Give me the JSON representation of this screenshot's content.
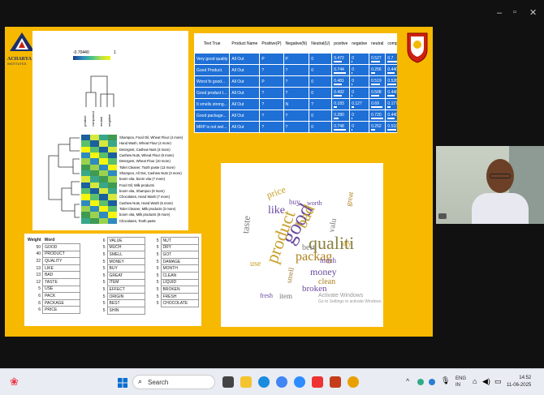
{
  "window_controls": {
    "minimize": "–",
    "maximize": "▫",
    "close": "✕"
  },
  "logo_left": {
    "text": "ACHARYA",
    "sub": "INSTITUTES"
  },
  "heatmap": {
    "scale_min": "-0.70440",
    "scale_max": "1",
    "columns": [
      "positive",
      "compound",
      "neutral",
      "negative"
    ],
    "rows": [
      "Shampoo, Food Oil, Wheat Flour (4 more)",
      "Hand Wash, Wheat Flour (4 more)",
      "Detergent, Cashew Nuts (3 more)",
      "Cashew Nuts, Wheat Flour (9 more)",
      "Detergent, Wheat Flour (10 more)",
      "Toilet Cleaner, Tooth paste (13 more)",
      "Shampoo, All Out, Cashew Nuts (3 more)",
      "boorn vita, boorn vita (7 more)",
      "Food Oil, Milk products",
      "boorn vita, Shampoo (8 more)",
      "Chocolates, Hand Wash (7 more)",
      "Cashew Nuts, Hand Wash (5 more)",
      "Toilet Cleaner, Milk products (3 more)",
      "boorn vita, Milk products (8 more)",
      "Chocolates, Tooth paste"
    ]
  },
  "sentiment_table": {
    "headers": [
      "Text True",
      "Product Name",
      "Positive(P)",
      "Negative(N)",
      "Neutral(U)",
      "positive",
      "negative",
      "neutral",
      "compound"
    ],
    "rows": [
      [
        "Very good quality",
        "All Out",
        "P",
        "P",
        "0",
        "0.472",
        "0",
        "0.527",
        "0.7"
      ],
      [
        "Good Product.",
        "All Out",
        "?",
        "?",
        "0",
        "0.744",
        "0",
        "0.256",
        "0.4404"
      ],
      [
        "Worst fo good...",
        "All Out",
        "P",
        "?",
        "0",
        "0.481",
        "0",
        "0.519",
        "0.5267"
      ],
      [
        "Good product t...",
        "All Out",
        "?",
        "?",
        "0",
        "0.492",
        "0",
        "0.508",
        "0.4404"
      ],
      [
        "It smells strong...",
        "All Out",
        "?",
        "N",
        "?",
        "0.183",
        "0.127",
        "0.69",
        "0.1779"
      ],
      [
        "Good package...",
        "All Out",
        "?",
        "?",
        "0",
        "0.280",
        "0",
        "0.720",
        "0.4404"
      ],
      [
        "MRP is not wel...",
        "All Out",
        "?",
        "?",
        "0",
        "0.748",
        "0",
        "0.252",
        "0.5106"
      ]
    ]
  },
  "word_table": {
    "col1": [
      [
        "Weight",
        "Word"
      ],
      [
        "50",
        "GOOD"
      ],
      [
        "40",
        "PRODUCT"
      ],
      [
        "22",
        "QUALITY"
      ],
      [
        "13",
        "LIKE"
      ],
      [
        "13",
        "BAD"
      ],
      [
        "12",
        "TASTE"
      ],
      [
        "5",
        "USE"
      ],
      [
        "6",
        "PACK"
      ],
      [
        "6",
        "PACKAGE"
      ],
      [
        "6",
        "PRICE"
      ]
    ],
    "col2": [
      [
        "6",
        "VALUE"
      ],
      [
        "5",
        "MUCH"
      ],
      [
        "5",
        "SMELL"
      ],
      [
        "5",
        "MONEY"
      ],
      [
        "5",
        "BUY"
      ],
      [
        "5",
        "GREAT"
      ],
      [
        "5",
        "ITEM"
      ],
      [
        "5",
        "EFFECT"
      ],
      [
        "5",
        "ORIGIN"
      ],
      [
        "5",
        "BEST"
      ],
      [
        "5",
        "SHIN"
      ]
    ],
    "col3": [
      [
        "5",
        "NUT"
      ],
      [
        "5",
        "DRY"
      ],
      [
        "5",
        "GOT"
      ],
      [
        "5",
        "DAMAGE"
      ],
      [
        "5",
        "MONTH"
      ],
      [
        "5",
        "CLEAN"
      ],
      [
        "5",
        "LIQUID"
      ],
      [
        "5",
        "BROKEN"
      ],
      [
        "5",
        "FRESH"
      ],
      [
        "5",
        "CHOCOLATE"
      ]
    ]
  },
  "cloud_words": [
    "good",
    "product",
    "qualiti",
    "bad",
    "like",
    "taste",
    "packag",
    "price",
    "money",
    "much",
    "best",
    "use",
    "clean",
    "broken",
    "smell",
    "valu",
    "buy",
    "item",
    "great",
    "worth",
    "dry",
    "fresh"
  ],
  "watermark": {
    "line1": "Activate Windows",
    "line2": "Go to Settings to activate Windows."
  },
  "taskbar": {
    "search": "Search",
    "lang1": "ENG",
    "lang2": "IN",
    "time": "14:52",
    "date": "11-06-2025"
  }
}
